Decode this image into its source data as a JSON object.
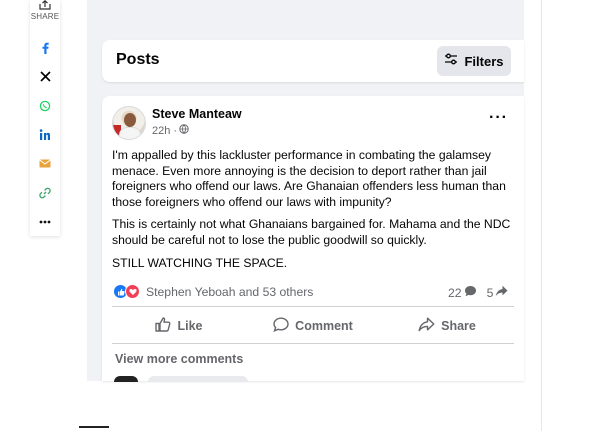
{
  "share": {
    "label": "SHARE",
    "buttons": [
      "facebook-icon",
      "x-icon",
      "whatsapp-icon",
      "linkedin-icon",
      "email-icon",
      "link-icon",
      "more-icon"
    ],
    "colors": {
      "facebook": "#1877f2",
      "x": "#000000",
      "whatsapp": "#25d366",
      "linkedin": "#0a66c2",
      "email": "#e8a33d",
      "link": "#3ea66b"
    }
  },
  "posts_header": {
    "title": "Posts",
    "filters_label": "Filters"
  },
  "post": {
    "author": "Steve Manteaw",
    "time": "22h ·",
    "paragraphs": [
      "I'm appalled  by this lackluster performance in combating the galamsey menace. Even more annoying is the decision to deport rather than jail foreigners who offend our laws. Are Ghanaian offenders less human than those foreigners who offend our laws with impunity?",
      "This is certainly not what Ghanaians bargained for. Mahama and the NDC should be careful not to lose the public goodwill so quickly.",
      "STILL WATCHING THE SPACE."
    ],
    "reactions_text": "Stephen Yeboah and 53 others",
    "comments_count": "22",
    "shares_count": "5",
    "actions": {
      "like": "Like",
      "comment": "Comment",
      "share": "Share"
    },
    "view_more": "View more comments"
  },
  "colors": {
    "accent": "#1877f2",
    "love": "#f33e58",
    "secondary_text": "#65676b",
    "feed_bg": "#f0f2f5"
  }
}
